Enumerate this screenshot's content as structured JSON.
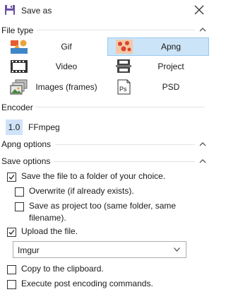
{
  "window": {
    "title": "Save as"
  },
  "file_type": {
    "title": "File type",
    "items": [
      {
        "label": "Gif"
      },
      {
        "label": "Apng"
      },
      {
        "label": "Video"
      },
      {
        "label": "Project"
      },
      {
        "label": "Images (frames)"
      },
      {
        "label": "PSD"
      }
    ]
  },
  "encoder": {
    "title": "Encoder",
    "badge": "1.0",
    "name": "FFmpeg"
  },
  "apng_options": {
    "title": "Apng options"
  },
  "save_options": {
    "title": "Save options",
    "save_to_folder": {
      "label": "Save the file to a folder of your choice.",
      "checked": true
    },
    "overwrite": {
      "label": "Overwrite (if already exists).",
      "checked": false
    },
    "save_as_project": {
      "label_line1": "Save as project too (same folder, same",
      "label_line2": "filename).",
      "checked": false
    },
    "upload": {
      "label": "Upload the file.",
      "checked": true
    },
    "upload_service": {
      "value": "Imgur"
    },
    "copy_clipboard": {
      "label": "Copy to the clipboard.",
      "checked": false
    },
    "post_commands": {
      "label": "Execute post encoding commands.",
      "checked": false
    }
  }
}
